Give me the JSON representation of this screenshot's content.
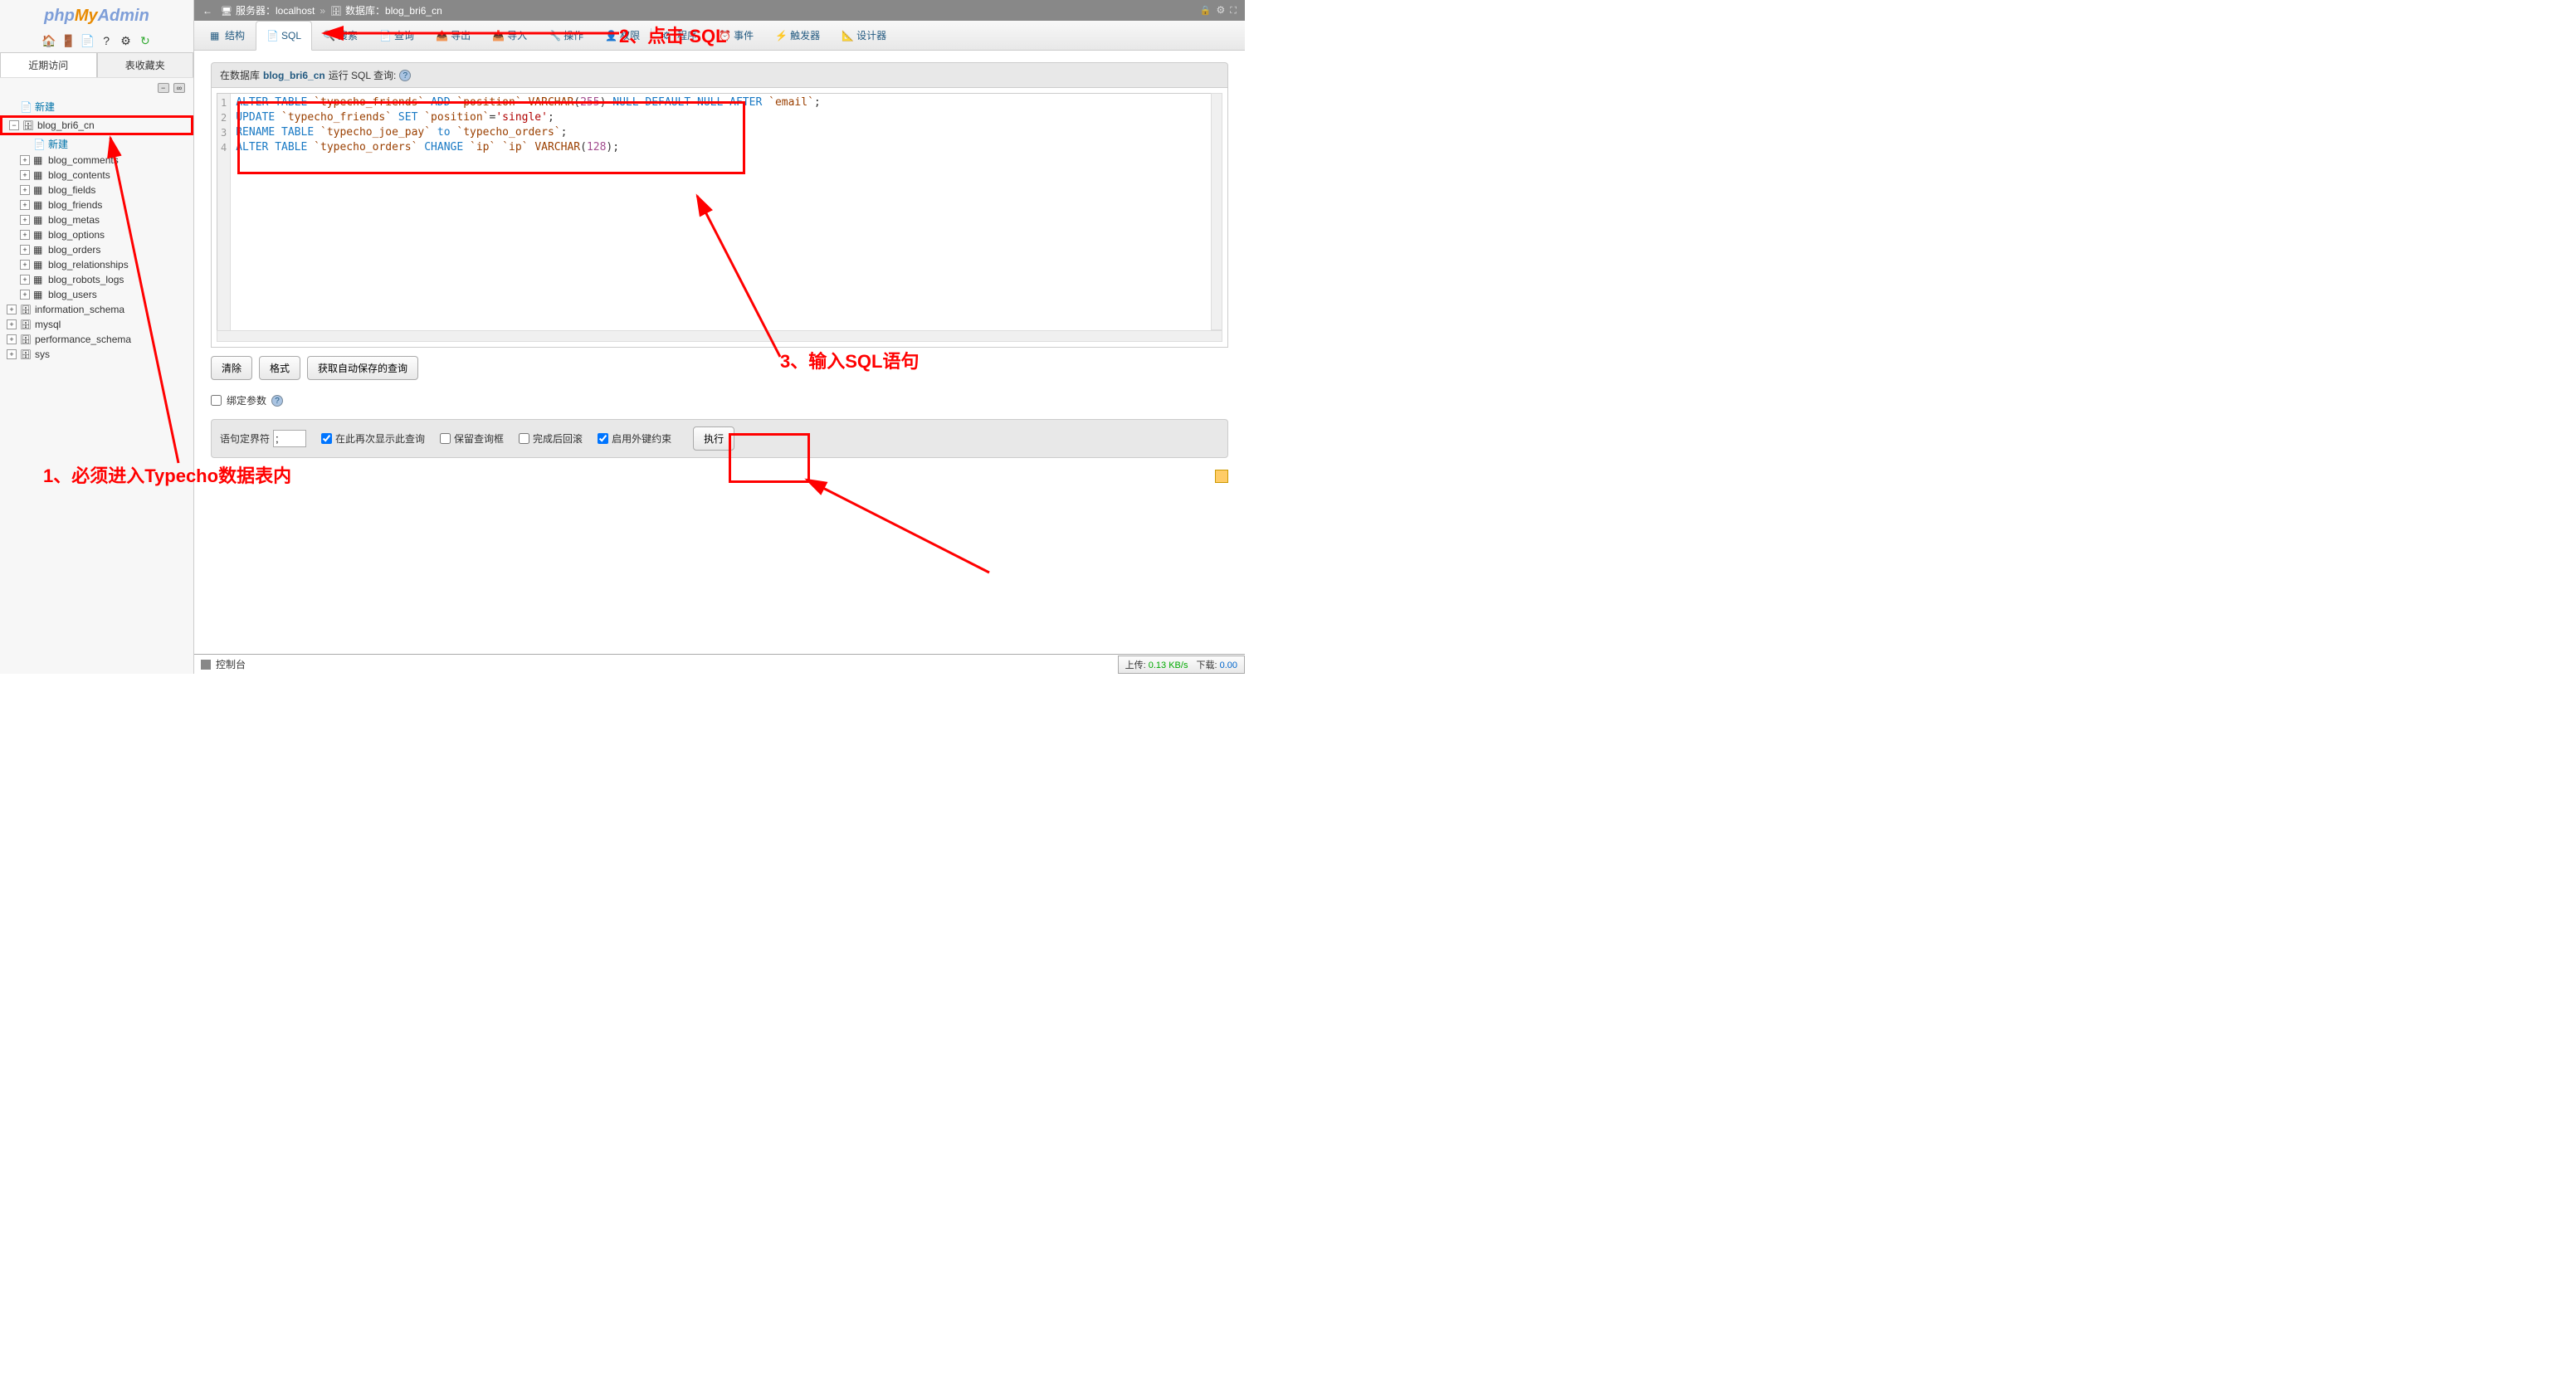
{
  "logo": {
    "php": "php",
    "my": "My",
    "admin": "Admin"
  },
  "sidebar": {
    "recent_btn": "近期访问",
    "fav_btn": "表收藏夹",
    "new_label": "新建",
    "tree": [
      {
        "name": "blog_bri6_cn",
        "highlight": true,
        "expanded": true,
        "children_new": "新建",
        "children": [
          "blog_comments",
          "blog_contents",
          "blog_fields",
          "blog_friends",
          "blog_metas",
          "blog_options",
          "blog_orders",
          "blog_relationships",
          "blog_robots_logs",
          "blog_users"
        ]
      },
      {
        "name": "information_schema"
      },
      {
        "name": "mysql"
      },
      {
        "name": "performance_schema"
      },
      {
        "name": "sys"
      }
    ]
  },
  "breadcrumb": {
    "server_label": "服务器：",
    "server_value": "localhost",
    "db_label": "数据库：",
    "db_value": "blog_bri6_cn"
  },
  "tabs": [
    {
      "id": "structure",
      "label": "结构",
      "icon": "ic-table"
    },
    {
      "id": "sql",
      "label": "SQL",
      "icon": "ic-sql",
      "active": true
    },
    {
      "id": "search",
      "label": "搜索",
      "icon": "ic-search"
    },
    {
      "id": "query",
      "label": "查询",
      "icon": "ic-sql"
    },
    {
      "id": "export",
      "label": "导出",
      "icon": "ic-export"
    },
    {
      "id": "import",
      "label": "导入",
      "icon": "ic-import"
    },
    {
      "id": "operations",
      "label": "操作",
      "icon": "ic-op"
    },
    {
      "id": "privileges",
      "label": "权限",
      "icon": "ic-priv"
    },
    {
      "id": "procedures",
      "label": "程序",
      "icon": "ic-proc"
    },
    {
      "id": "events",
      "label": "事件",
      "icon": "ic-event"
    },
    {
      "id": "triggers",
      "label": "触发器",
      "icon": "ic-trig"
    },
    {
      "id": "designer",
      "label": "设计器",
      "icon": "ic-design"
    }
  ],
  "panel": {
    "prefix": "在数据库 ",
    "db": "blog_bri6_cn",
    "suffix": " 运行 SQL 查询:"
  },
  "sql_lines": [
    {
      "n": 1,
      "tokens": [
        [
          "kw1",
          "ALTER"
        ],
        [
          " ",
          ""
        ],
        [
          "kw1",
          "TABLE"
        ],
        [
          " ",
          ""
        ],
        [
          "ident",
          "`typecho_friends`"
        ],
        [
          " ",
          ""
        ],
        [
          "kw1",
          "ADD"
        ],
        [
          " ",
          ""
        ],
        [
          "ident",
          "`position`"
        ],
        [
          " ",
          ""
        ],
        [
          "func",
          "VARCHAR"
        ],
        [
          "",
          "("
        ],
        [
          "num",
          "255"
        ],
        [
          "",
          ")"
        ],
        [
          " ",
          ""
        ],
        [
          "kw1",
          "NULL"
        ],
        [
          " ",
          ""
        ],
        [
          "kw1",
          "DEFAULT"
        ],
        [
          " ",
          ""
        ],
        [
          "kw1",
          "NULL"
        ],
        [
          " ",
          ""
        ],
        [
          "kw1",
          "AFTER"
        ],
        [
          " ",
          ""
        ],
        [
          "ident",
          "`email`"
        ],
        [
          "",
          ";"
        ]
      ]
    },
    {
      "n": 2,
      "tokens": [
        [
          "kw1",
          "UPDATE"
        ],
        [
          " ",
          ""
        ],
        [
          "ident",
          "`typecho_friends`"
        ],
        [
          " ",
          ""
        ],
        [
          "kw1",
          "SET"
        ],
        [
          " ",
          ""
        ],
        [
          "ident",
          "`position`"
        ],
        [
          "",
          "="
        ],
        [
          "str",
          "'single'"
        ],
        [
          "",
          ";"
        ]
      ]
    },
    {
      "n": 3,
      "tokens": [
        [
          "kw1",
          "RENAME"
        ],
        [
          " ",
          ""
        ],
        [
          "kw1",
          "TABLE"
        ],
        [
          " ",
          ""
        ],
        [
          "ident",
          "`typecho_joe_pay`"
        ],
        [
          " ",
          ""
        ],
        [
          "kw1",
          "to"
        ],
        [
          " ",
          ""
        ],
        [
          "ident",
          "`typecho_orders`"
        ],
        [
          "",
          ";"
        ]
      ]
    },
    {
      "n": 4,
      "tokens": [
        [
          "kw1",
          "ALTER"
        ],
        [
          " ",
          ""
        ],
        [
          "kw1",
          "TABLE"
        ],
        [
          " ",
          ""
        ],
        [
          "ident",
          "`typecho_orders`"
        ],
        [
          " ",
          ""
        ],
        [
          "kw1",
          "CHANGE"
        ],
        [
          " ",
          ""
        ],
        [
          "ident",
          "`ip`"
        ],
        [
          " ",
          ""
        ],
        [
          "ident",
          "`ip`"
        ],
        [
          " ",
          ""
        ],
        [
          "func",
          "VARCHAR"
        ],
        [
          "",
          "("
        ],
        [
          "num",
          "128"
        ],
        [
          "",
          ")"
        ],
        [
          "",
          ";"
        ]
      ]
    }
  ],
  "buttons": {
    "clear": "清除",
    "format": "格式",
    "autosave": "获取自动保存的查询"
  },
  "bind_params": "绑定参数",
  "options": {
    "delimiter_label": "语句定界符",
    "delimiter_value": ";",
    "show_again": "在此再次显示此查询",
    "keep_query": "保留查询框",
    "rollback": "完成后回滚",
    "fk_check": "启用外键约束",
    "execute": "执行"
  },
  "console": "控制台",
  "status": {
    "up_label": "上传:",
    "up_value": "0.13 KB/s",
    "down_label": "下载:",
    "down_value": "0.00"
  },
  "annotations": {
    "a1": "1、必须进入Typecho数据表内",
    "a2": "2、点击 SQL",
    "a3": "3、输入SQL语句"
  }
}
